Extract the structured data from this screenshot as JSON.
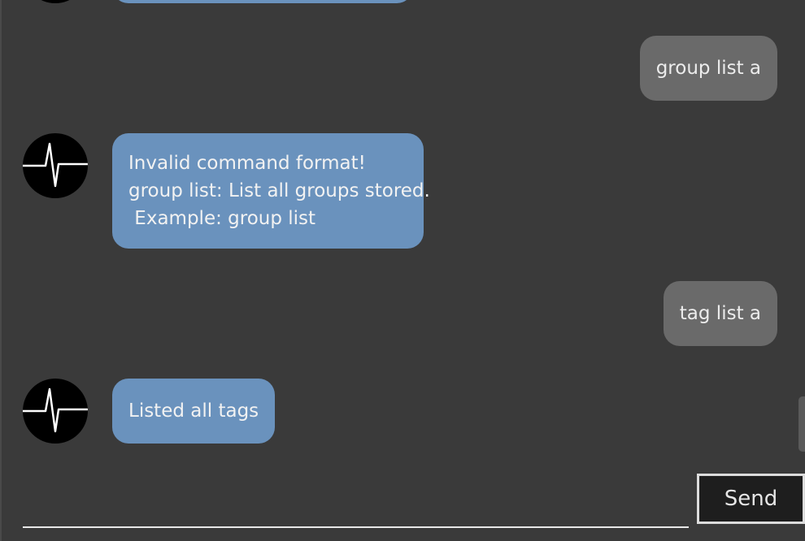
{
  "conversation": {
    "messages": [
      {
        "sender": "user",
        "text": "group list a"
      },
      {
        "sender": "bot",
        "lines": [
          "Invalid command format!",
          "group list: List all groups stored.",
          " Example: group list"
        ]
      },
      {
        "sender": "user",
        "text": "tag list a"
      },
      {
        "sender": "bot",
        "lines": [
          "Listed all tags"
        ]
      }
    ]
  },
  "input": {
    "value": "",
    "placeholder": ""
  },
  "send_button": {
    "label": "Send"
  },
  "colors": {
    "background": "#3a3a3a",
    "bot_bubble": "#6a92bd",
    "user_bubble": "#6a6a6a",
    "avatar": "#000000",
    "send_button_bg": "#1e1e1e"
  },
  "icons": {
    "avatar": "heartbeat-pulse-icon"
  }
}
